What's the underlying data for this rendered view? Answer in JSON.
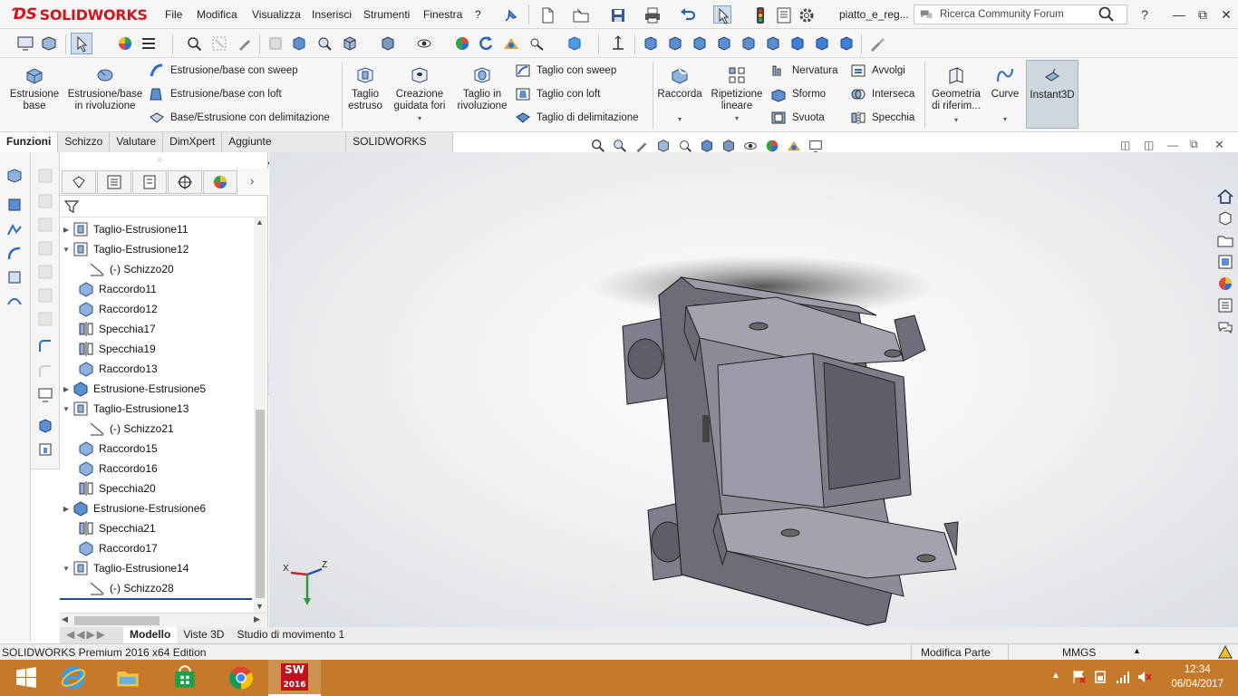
{
  "app": {
    "brand": "SOLIDWORKS",
    "document_name": "piatto_e_reg..."
  },
  "menu": [
    "File",
    "Modifica",
    "Visualizza",
    "Inserisci",
    "Strumenti",
    "Finestra",
    "?"
  ],
  "search": {
    "placeholder": "Ricerca Community Forum"
  },
  "titlebar_help": "?",
  "command_manager": {
    "big_buttons": [
      {
        "label": "Estrusione base"
      },
      {
        "label": "Estrusione/base in rivoluzione"
      },
      {
        "label": "Taglio estruso"
      },
      {
        "label": "Creazione guidata fori"
      },
      {
        "label": "Taglio in rivoluzione"
      },
      {
        "label": "Raccorda"
      },
      {
        "label": "Ripetizione lineare"
      },
      {
        "label": "Geometria di riferim..."
      },
      {
        "label": "Curve"
      },
      {
        "label": "Instant3D"
      }
    ],
    "small_buttons": [
      {
        "label": "Estrusione/base con sweep"
      },
      {
        "label": "Estrusione/base con loft"
      },
      {
        "label": "Base/Estrusione con delimitazione"
      },
      {
        "label": "Taglio con sweep"
      },
      {
        "label": "Taglio con loft"
      },
      {
        "label": "Taglio di delimitazione"
      },
      {
        "label": "Nervatura"
      },
      {
        "label": "Sformo"
      },
      {
        "label": "Svuota"
      },
      {
        "label": "Avvolgi"
      },
      {
        "label": "Interseca"
      },
      {
        "label": "Specchia"
      }
    ]
  },
  "tabs": [
    "Funzioni",
    "Schizzo",
    "Valutare",
    "DimXpert",
    "Aggiunte SOLIDWORKS",
    "SOLIDWORKS MBD"
  ],
  "feature_tree": [
    {
      "label": "Taglio-Estrusione11",
      "expander": "▶",
      "indent": 0,
      "icon": "cut-extrude-icon"
    },
    {
      "label": "Taglio-Estrusione12",
      "expander": "▼",
      "indent": 0,
      "icon": "cut-extrude-icon"
    },
    {
      "label": "(-) Schizzo20",
      "expander": "",
      "indent": 1,
      "icon": "sketch-icon"
    },
    {
      "label": "Raccordo11",
      "expander": "",
      "indent": 0,
      "icon": "fillet-icon"
    },
    {
      "label": "Raccordo12",
      "expander": "",
      "indent": 0,
      "icon": "fillet-icon"
    },
    {
      "label": "Specchia17",
      "expander": "",
      "indent": 0,
      "icon": "mirror-icon"
    },
    {
      "label": "Specchia19",
      "expander": "",
      "indent": 0,
      "icon": "mirror-icon"
    },
    {
      "label": "Raccordo13",
      "expander": "",
      "indent": 0,
      "icon": "fillet-icon"
    },
    {
      "label": "Estrusione-Estrusione5",
      "expander": "▶",
      "indent": 0,
      "icon": "extrude-icon"
    },
    {
      "label": "Taglio-Estrusione13",
      "expander": "▼",
      "indent": 0,
      "icon": "cut-extrude-icon"
    },
    {
      "label": "(-) Schizzo21",
      "expander": "",
      "indent": 1,
      "icon": "sketch-icon"
    },
    {
      "label": "Raccordo15",
      "expander": "",
      "indent": 0,
      "icon": "fillet-icon"
    },
    {
      "label": "Raccordo16",
      "expander": "",
      "indent": 0,
      "icon": "fillet-icon"
    },
    {
      "label": "Specchia20",
      "expander": "",
      "indent": 0,
      "icon": "mirror-icon"
    },
    {
      "label": "Estrusione-Estrusione6",
      "expander": "▶",
      "indent": 0,
      "icon": "extrude-icon"
    },
    {
      "label": "Specchia21",
      "expander": "",
      "indent": 0,
      "icon": "mirror-icon"
    },
    {
      "label": "Raccordo17",
      "expander": "",
      "indent": 0,
      "icon": "fillet-icon"
    },
    {
      "label": "Taglio-Estrusione14",
      "expander": "▼",
      "indent": 0,
      "icon": "cut-extrude-icon"
    },
    {
      "label": "(-) Schizzo28",
      "expander": "",
      "indent": 1,
      "icon": "sketch-icon"
    }
  ],
  "bottom_tabs": [
    "Modello",
    "Viste 3D",
    "Studio di movimento 1"
  ],
  "statusbar": {
    "left": "SOLIDWORKS Premium 2016 x64 Edition",
    "mode": "Modifica Parte",
    "units": "MMGS"
  },
  "triad": {
    "x": "X",
    "z": "Z"
  },
  "taskbar": {
    "time": "12:34",
    "date": "06/04/2017",
    "sw_badge": "2016"
  },
  "colors": {
    "brand_red": "#d8121b",
    "taskbar": "#c47a2a",
    "model_gray": "#8c8c99",
    "instant3d_bg": "#cfd6de"
  }
}
